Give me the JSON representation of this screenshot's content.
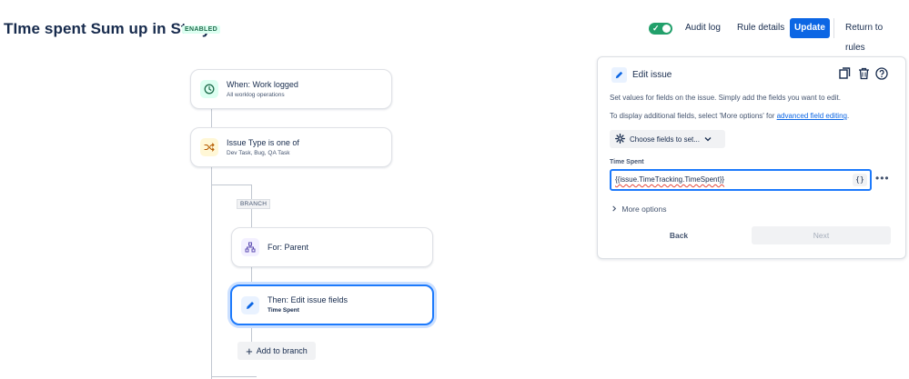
{
  "header": {
    "title": "TIme spent Sum up in Story",
    "status_badge": "ENABLED",
    "toggle_state": "on",
    "audit_log": "Audit log",
    "rule_details": "Rule details",
    "update": "Update",
    "return_to_rules": "Return to rules"
  },
  "flow": {
    "trigger": {
      "title": "When: Work logged",
      "subtitle": "All worklog operations",
      "icon": "clock-icon"
    },
    "condition": {
      "title": "Issue Type is one of",
      "subtitle": "Dev Task, Bug, QA Task",
      "icon": "shuffle-icon"
    },
    "branch_tag": "BRANCH",
    "branch": {
      "title": "For: Parent",
      "icon": "hierarchy-icon"
    },
    "action": {
      "title": "Then: Edit issue fields",
      "subtitle": "Time Spent",
      "icon": "pencil-icon"
    },
    "add_to_branch": "Add to branch"
  },
  "panel": {
    "title": "Edit issue",
    "description": "Set values for fields on the issue. Simply add the fields you want to edit.",
    "more_info_prefix": "To display additional fields, select 'More options' for ",
    "more_info_link": "advanced field editing",
    "more_info_suffix": ".",
    "choose_fields": "Choose fields to set...",
    "field_label": "Time Spent",
    "field_value": "{{issue.TimeTracking.TimeSpent}}",
    "smart_value_button": "{}",
    "more_options": "More options",
    "back": "Back",
    "next": "Next"
  },
  "colors": {
    "primary": "#0c66e4",
    "enabled_green": "#22a06b",
    "selected_border": "#1d7afc"
  }
}
